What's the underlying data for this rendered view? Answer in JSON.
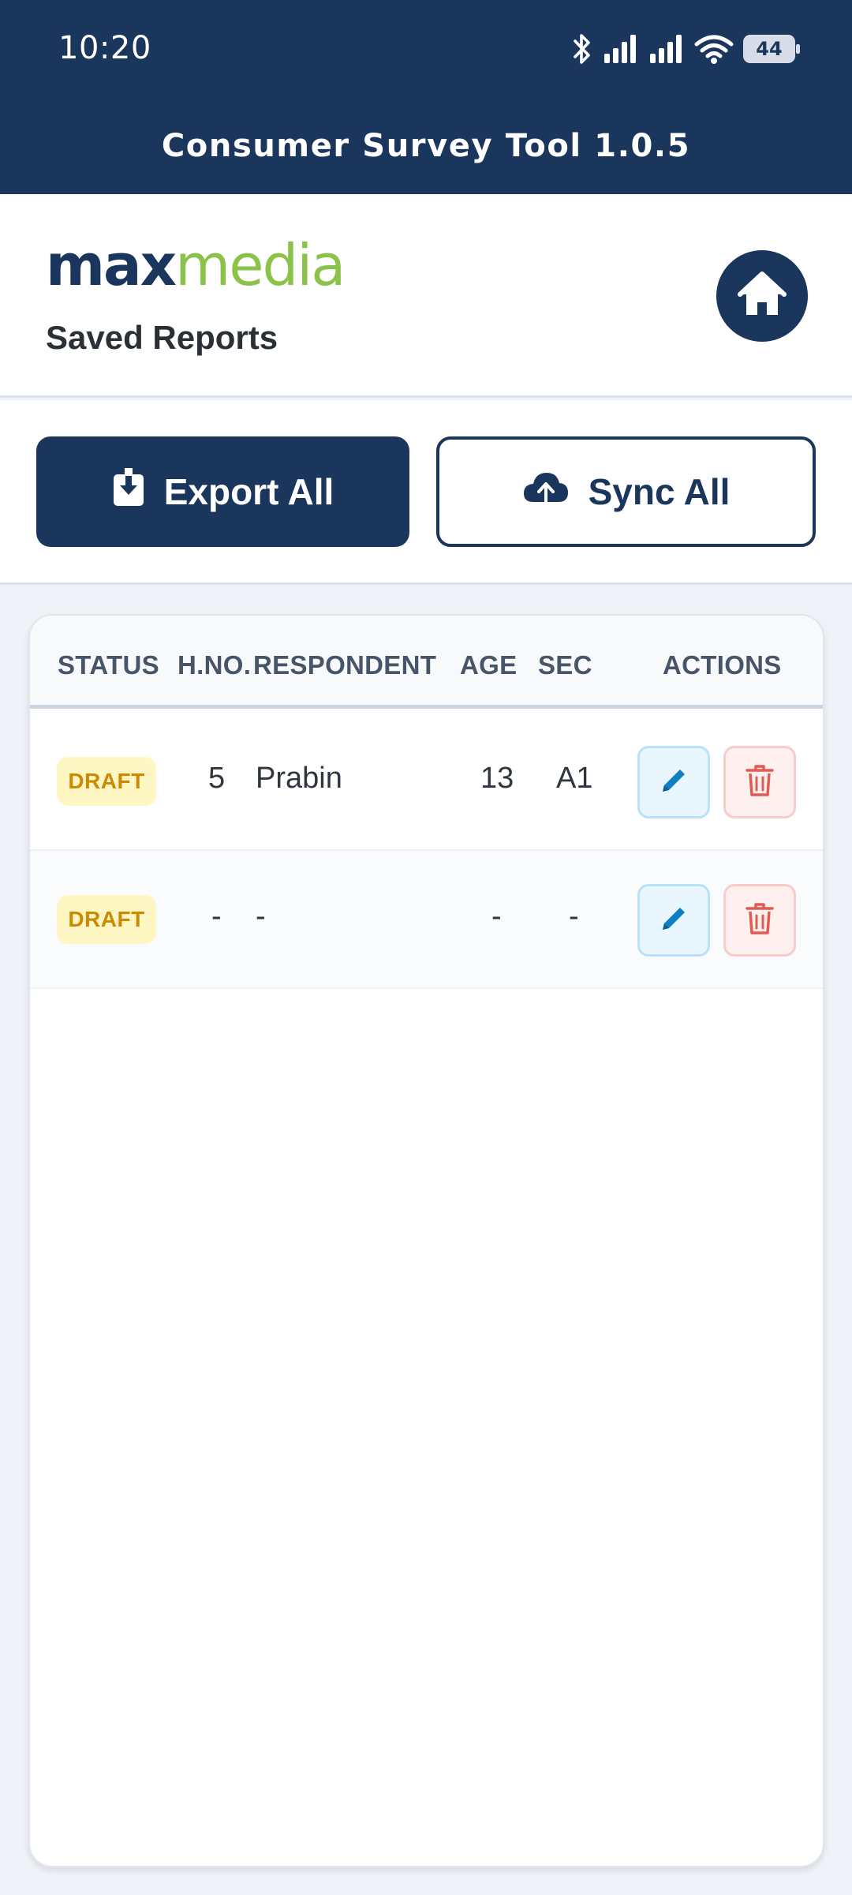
{
  "status_bar": {
    "time": "10:20",
    "battery": "44",
    "icons": [
      "bluetooth-icon",
      "signal-icon",
      "signal-icon",
      "wifi-icon",
      "battery-icon"
    ]
  },
  "app_bar": {
    "title": "Consumer Survey Tool 1.0.5"
  },
  "header": {
    "logo_max": "max",
    "logo_media": "media",
    "page_title": "Saved Reports",
    "home_icon": "home-icon"
  },
  "actions": {
    "export_label": "Export All",
    "export_icon": "download-icon",
    "sync_label": "Sync All",
    "sync_icon": "cloud-upload-icon"
  },
  "table": {
    "columns": [
      "STATUS",
      "H.NO.",
      "RESPONDENT",
      "AGE",
      "SEC",
      "ACTIONS"
    ],
    "rows": [
      {
        "status": "DRAFT",
        "hno": "5",
        "respondent": "Prabin",
        "age": "13",
        "sec": "A1"
      },
      {
        "status": "DRAFT",
        "hno": "-",
        "respondent": "-",
        "age": "-",
        "sec": "-"
      }
    ]
  },
  "colors": {
    "brand_navy": "#1b365d",
    "brand_green": "#8bc34a",
    "draft_bg": "#fef7c3",
    "draft_text": "#ca8a04",
    "edit_accent": "#0e7fc0",
    "delete_accent": "#e25b52"
  }
}
